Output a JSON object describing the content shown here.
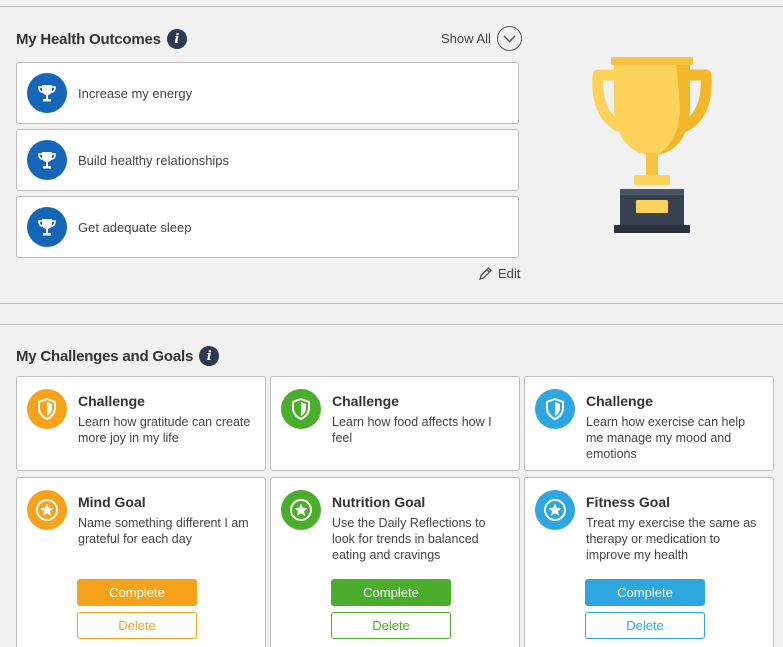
{
  "outcomes_section": {
    "title": "My Health Outcomes",
    "show_all_label": "Show All",
    "edit_label": "Edit",
    "items": [
      {
        "label": "Increase my energy"
      },
      {
        "label": "Build healthy relationships"
      },
      {
        "label": "Get adequate sleep"
      }
    ]
  },
  "challenges_section": {
    "title": "My Challenges and Goals",
    "challenges": [
      {
        "title": "Challenge",
        "description": "Learn how gratitude can create more joy in my life",
        "color": "#f7a21b"
      },
      {
        "title": "Challenge",
        "description": "Learn how food affects how I feel",
        "color": "#4aad2b"
      },
      {
        "title": "Challenge",
        "description": "Learn how exercise can help me manage my mood and emotions",
        "color": "#2ea6df"
      }
    ],
    "goals": [
      {
        "title": "Mind Goal",
        "description": "Name something different I am grateful for each day",
        "color": "#f7a21b",
        "complete_label": "Complete",
        "delete_label": "Delete"
      },
      {
        "title": "Nutrition Goal",
        "description": "Use the Daily Reflections to look for trends in balanced eating and cravings",
        "color": "#4aad2b",
        "complete_label": "Complete",
        "delete_label": "Delete"
      },
      {
        "title": "Fitness Goal",
        "description": "Treat my exercise the same as therapy or medication to improve my health",
        "color": "#2ea6df",
        "complete_label": "Complete",
        "delete_label": "Delete"
      }
    ]
  },
  "icons": {
    "info": "info-icon",
    "outcome": "trophy-icon",
    "challenge": "shield-icon",
    "goal": "star-icon",
    "show_all": "chevron-down-icon",
    "edit": "pencil-icon",
    "illustration": "gold-trophy-icon"
  },
  "colors": {
    "outcome_icon_bg": "#1565b8",
    "info_icon_bg": "#2b3a4f",
    "trophy_gold": "#fcd25a"
  }
}
